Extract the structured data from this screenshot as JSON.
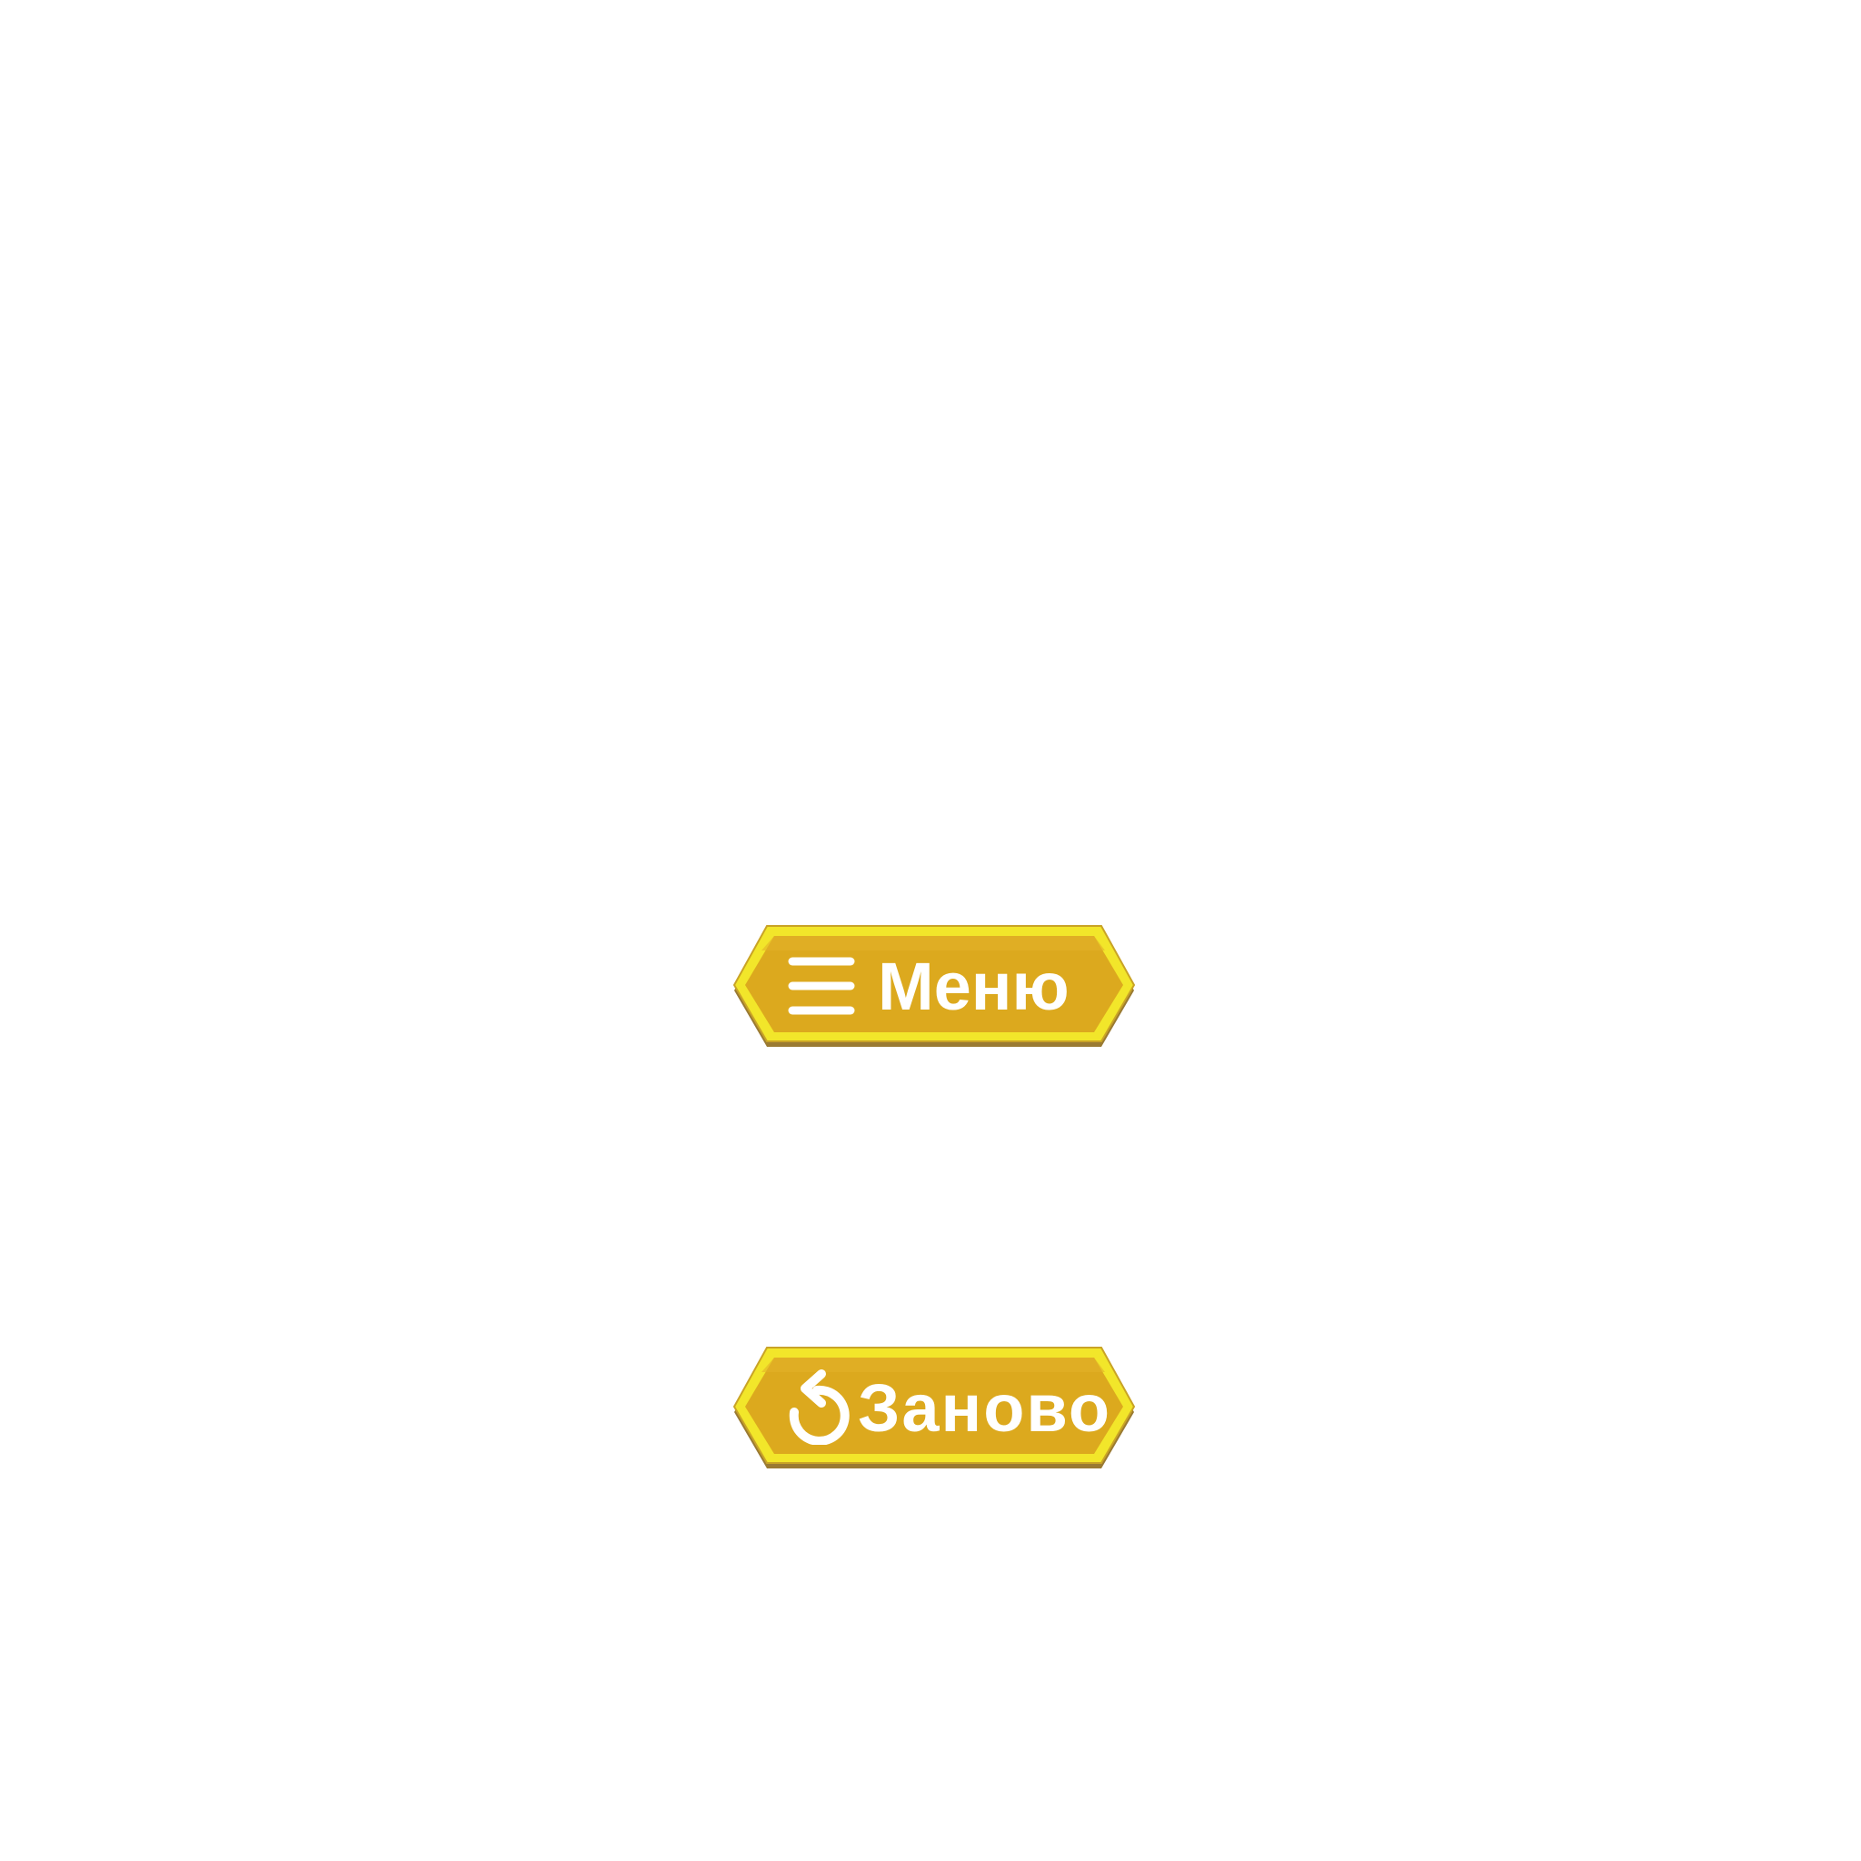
{
  "buttons": {
    "menu": {
      "label": "Меню",
      "icon": "hamburger-menu-icon"
    },
    "restart": {
      "label": "Заново",
      "icon": "restart-icon"
    }
  },
  "colors": {
    "background": "#ffffff",
    "button_fill": "#dca91e",
    "button_border": "#f2e62a",
    "button_shadow": "#9a7a32",
    "label": "#ffffff"
  }
}
